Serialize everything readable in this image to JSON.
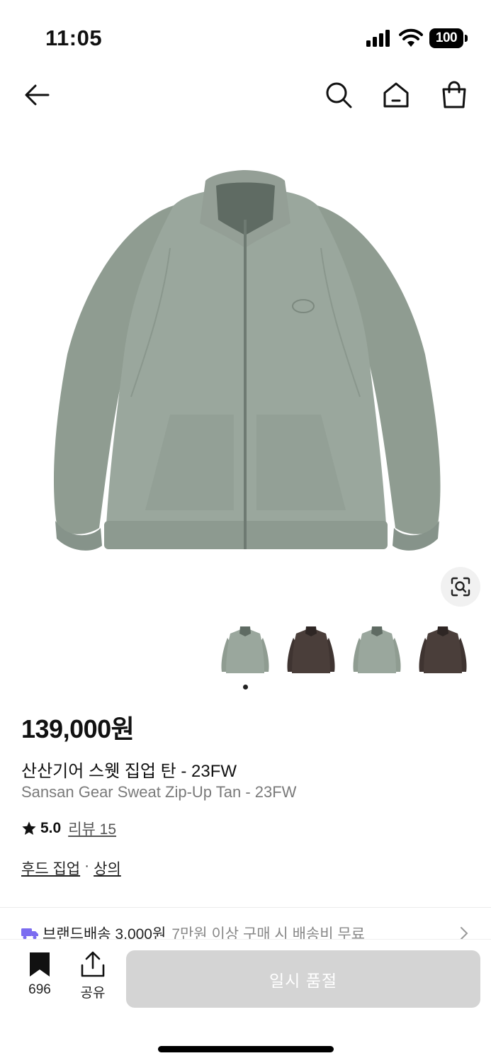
{
  "status": {
    "time": "11:05",
    "battery": "100"
  },
  "product": {
    "price": "139,000원",
    "title_ko": "산산기어 스웻 집업 탄 - 23FW",
    "title_en": "Sansan Gear Sweat Zip-Up Tan  - 23FW",
    "rating": "5.0",
    "review_label": "리뷰 15",
    "categories": [
      "후드 집업",
      "상의"
    ],
    "category_separator": "·",
    "image_colors": [
      "#9aa79d",
      "#4a3e3a",
      "#9aa79d",
      "#4a3e3a"
    ]
  },
  "shipping": {
    "main": "브랜드배송 3,000원",
    "sub": "7만원 이상 구매 시 배송비 무료"
  },
  "bottom": {
    "bookmark_count": "696",
    "share_label": "공유",
    "buy_label": "일시 품절"
  },
  "icons": {
    "back": "arrow-left-icon",
    "search": "search-icon",
    "home": "home-icon",
    "cart": "shopping-bag-icon",
    "lens": "image-search-icon",
    "star": "star-icon",
    "bookmark": "bookmark-icon",
    "share": "share-icon"
  },
  "colors": {
    "accent_truck": "#7b6cf0",
    "buy_disabled": "#d4d4d4"
  }
}
